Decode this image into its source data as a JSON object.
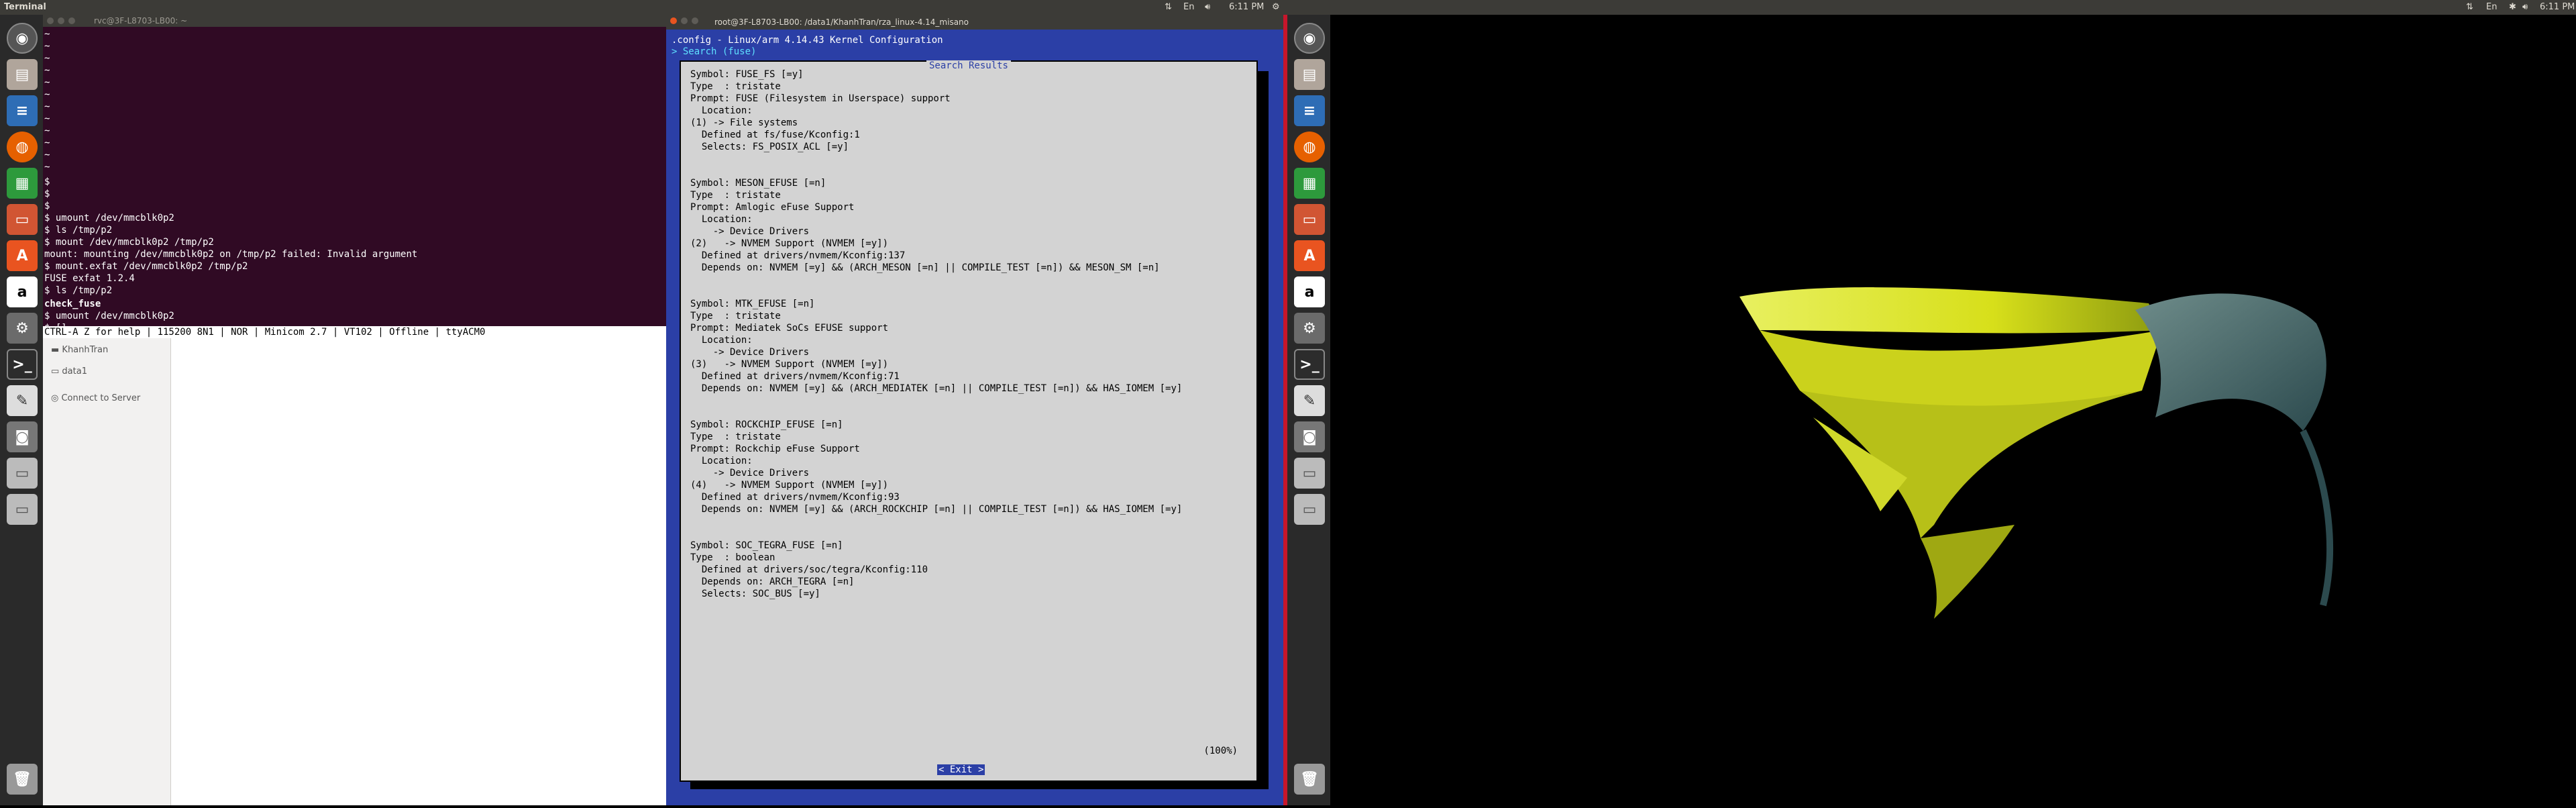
{
  "topbar": {
    "app_title": "Terminal",
    "clock_left": "6:11 PM",
    "clock_right": "6:11 PM"
  },
  "terminal": {
    "title": "rvc@3F-L8703-LB00: ~",
    "tildes": [
      "~",
      "~",
      "~",
      "~",
      "~",
      "~",
      "~",
      "~",
      "~",
      "~",
      "~",
      "~"
    ],
    "lines": [
      "$",
      "$",
      "$",
      "$ umount /dev/mmcblk0p2",
      "$ ls /tmp/p2",
      "$ mount /dev/mmcblk0p2 /tmp/p2",
      "mount: mounting /dev/mmcblk0p2 on /tmp/p2 failed: Invalid argument",
      "$ mount.exfat /dev/mmcblk0p2 /tmp/p2",
      "FUSE exfat 1.2.4",
      "$ ls /tmp/p2"
    ],
    "green_line": "check_fuse",
    "after_lines": [
      "$ umount /dev/mmcblk0p2",
      "$ []"
    ],
    "status": "CTRL-A Z for help | 115200 8N1 | NOR | Minicom 2.7 | VT102 | Offline | ttyACM0"
  },
  "files": {
    "items": [
      "KhanhTran",
      "data1"
    ],
    "connect": "Connect to Server"
  },
  "kconfig": {
    "window_title": "root@3F-L8703-LB00: /data1/KhanhTran/rza_linux-4.14_misano",
    "config_title": ".config - Linux/arm 4.14.43 Kernel Configuration",
    "search_label": "> Search (fuse)",
    "dialog_title": "Search Results",
    "content": [
      "Symbol: FUSE_FS [=y]",
      "Type  : tristate",
      "Prompt: FUSE (Filesystem in Userspace) support",
      "  Location:",
      "(1) -> File systems",
      "  Defined at fs/fuse/Kconfig:1",
      "  Selects: FS_POSIX_ACL [=y]",
      "",
      "",
      "Symbol: MESON_EFUSE [=n]",
      "Type  : tristate",
      "Prompt: Amlogic eFuse Support",
      "  Location:",
      "    -> Device Drivers",
      "(2)   -> NVMEM Support (NVMEM [=y])",
      "  Defined at drivers/nvmem/Kconfig:137",
      "  Depends on: NVMEM [=y] && (ARCH_MESON [=n] || COMPILE_TEST [=n]) && MESON_SM [=n]",
      "",
      "",
      "Symbol: MTK_EFUSE [=n]",
      "Type  : tristate",
      "Prompt: Mediatek SoCs EFUSE support",
      "  Location:",
      "    -> Device Drivers",
      "(3)   -> NVMEM Support (NVMEM [=y])",
      "  Defined at drivers/nvmem/Kconfig:71",
      "  Depends on: NVMEM [=y] && (ARCH_MEDIATEK [=n] || COMPILE_TEST [=n]) && HAS_IOMEM [=y]",
      "",
      "",
      "Symbol: ROCKCHIP_EFUSE [=n]",
      "Type  : tristate",
      "Prompt: Rockchip eFuse Support",
      "  Location:",
      "    -> Device Drivers",
      "(4)   -> NVMEM Support (NVMEM [=y])",
      "  Defined at drivers/nvmem/Kconfig:93",
      "  Depends on: NVMEM [=y] && (ARCH_ROCKCHIP [=n] || COMPILE_TEST [=n]) && HAS_IOMEM [=y]",
      "",
      "",
      "Symbol: SOC_TEGRA_FUSE [=n]",
      "Type  : boolean",
      "  Defined at drivers/soc/tegra/Kconfig:110",
      "  Depends on: ARCH_TEGRA [=n]",
      "  Selects: SOC_BUS [=y]"
    ],
    "percent": "(100%)",
    "exit_label": "< Exit >"
  },
  "colors": {
    "terminal_bg": "#300a24",
    "kconfig_bg": "#2b3fa6",
    "dialog_bg": "#d3d3d3",
    "divider": "#c7162b"
  },
  "icons": {
    "launcher": [
      "ubuntu-dash-icon",
      "files-icon",
      "document-icon",
      "firefox-icon",
      "spreadsheet-icon",
      "presentation-icon",
      "software-center-icon",
      "amazon-icon",
      "settings-icon",
      "terminal-icon",
      "text-editor-icon",
      "camera-icon",
      "drive-icon",
      "drive-icon",
      "trash-icon"
    ]
  }
}
